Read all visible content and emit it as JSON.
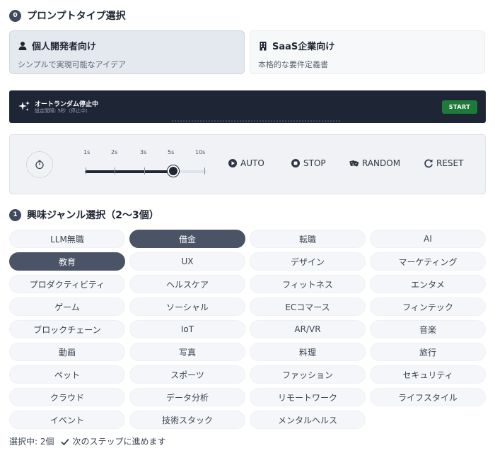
{
  "step0": {
    "badge": "0",
    "title": "プロンプトタイプ選択"
  },
  "prompt_types": [
    {
      "icon": "person-icon",
      "title": "個人開発者向け",
      "desc": "シンプルで実現可能なアイデア",
      "selected": true
    },
    {
      "icon": "building-icon",
      "title": "SaaS企業向け",
      "desc": "本格的な要件定義書",
      "selected": false
    }
  ],
  "banner": {
    "icon": "sparkle-icon",
    "title": "オートランダム停止中",
    "subtitle": "設定間隔: 5秒（停止中）",
    "start_label": "START",
    "accent": "#1f7a3a",
    "background": "#1e2636"
  },
  "controls": {
    "timer_icon": "timer-icon",
    "interval_ticks": [
      "1s",
      "2s",
      "3s",
      "5s",
      "10s"
    ],
    "selected_interval": "5s",
    "buttons": [
      {
        "icon": "play-circle-icon",
        "label": "AUTO"
      },
      {
        "icon": "stop-circle-icon",
        "label": "STOP"
      },
      {
        "icon": "dice-icon",
        "label": "RANDOM"
      },
      {
        "icon": "refresh-icon",
        "label": "RESET"
      }
    ]
  },
  "step1": {
    "badge": "1",
    "title": "興味ジャンル選択（2〜3個）"
  },
  "genres": [
    {
      "label": "LLM無職",
      "selected": false
    },
    {
      "label": "借金",
      "selected": true
    },
    {
      "label": "転職",
      "selected": false
    },
    {
      "label": "AI",
      "selected": false
    },
    {
      "label": "教育",
      "selected": true
    },
    {
      "label": "UX",
      "selected": false
    },
    {
      "label": "デザイン",
      "selected": false
    },
    {
      "label": "マーケティング",
      "selected": false
    },
    {
      "label": "プロダクティビティ",
      "selected": false
    },
    {
      "label": "ヘルスケア",
      "selected": false
    },
    {
      "label": "フィットネス",
      "selected": false
    },
    {
      "label": "エンタメ",
      "selected": false
    },
    {
      "label": "ゲーム",
      "selected": false
    },
    {
      "label": "ソーシャル",
      "selected": false
    },
    {
      "label": "ECコマース",
      "selected": false
    },
    {
      "label": "フィンテック",
      "selected": false
    },
    {
      "label": "ブロックチェーン",
      "selected": false
    },
    {
      "label": "IoT",
      "selected": false
    },
    {
      "label": "AR/VR",
      "selected": false
    },
    {
      "label": "音楽",
      "selected": false
    },
    {
      "label": "動画",
      "selected": false
    },
    {
      "label": "写真",
      "selected": false
    },
    {
      "label": "料理",
      "selected": false
    },
    {
      "label": "旅行",
      "selected": false
    },
    {
      "label": "ペット",
      "selected": false
    },
    {
      "label": "スポーツ",
      "selected": false
    },
    {
      "label": "ファッション",
      "selected": false
    },
    {
      "label": "セキュリティ",
      "selected": false
    },
    {
      "label": "クラウド",
      "selected": false
    },
    {
      "label": "データ分析",
      "selected": false
    },
    {
      "label": "リモートワーク",
      "selected": false
    },
    {
      "label": "ライフスタイル",
      "selected": false
    },
    {
      "label": "イベント",
      "selected": false
    },
    {
      "label": "技術スタック",
      "selected": false
    },
    {
      "label": "メンタルヘルス",
      "selected": false
    }
  ],
  "status": {
    "count_text": "選択中: 2個",
    "check_icon": "check-icon",
    "message": "次のステップに進めます"
  }
}
